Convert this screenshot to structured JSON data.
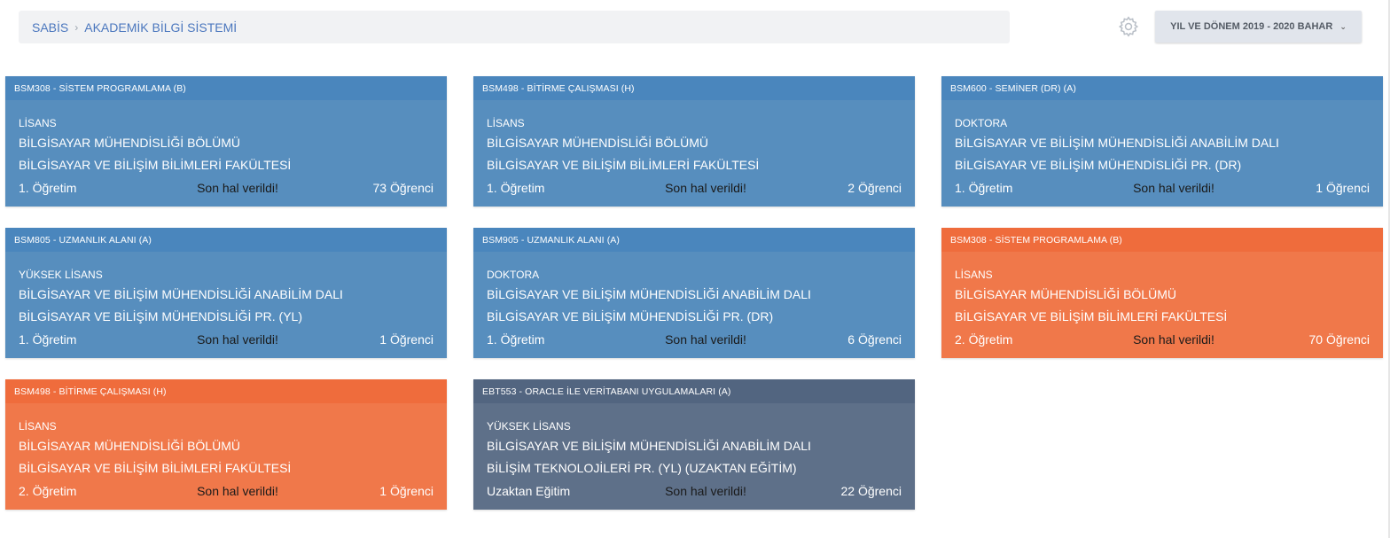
{
  "breadcrumb": {
    "root": "SABİS",
    "separator": "›",
    "current": "AKADEMİK BİLGİ SİSTEMİ"
  },
  "year_selector": {
    "label": "YIL VE DÖNEM 2019 - 2020 BAHAR",
    "chevron": "⌄"
  },
  "icons": {
    "settings": "gear-icon"
  },
  "colors": {
    "blue": "#578ebe",
    "orange": "#f0784a",
    "slate": "#5e7089"
  },
  "cards": [
    {
      "title": "BSM308 - SİSTEM PROGRAMLAMA (B)",
      "level": "LİSANS",
      "line1": "BİLGİSAYAR MÜHENDİSLİĞİ BÖLÜMÜ",
      "line2": "BİLGİSAYAR VE BİLİŞİM BİLİMLERİ FAKÜLTESİ",
      "education": "1. Öğretim",
      "status": "Son hal verildi!",
      "students": "73 Öğrenci",
      "theme": "blue"
    },
    {
      "title": "BSM498 - BİTİRME ÇALIŞMASI (H)",
      "level": "LİSANS",
      "line1": "BİLGİSAYAR MÜHENDİSLİĞİ BÖLÜMÜ",
      "line2": "BİLGİSAYAR VE BİLİŞİM BİLİMLERİ FAKÜLTESİ",
      "education": "1. Öğretim",
      "status": "Son hal verildi!",
      "students": "2 Öğrenci",
      "theme": "blue"
    },
    {
      "title": "BSM600 - SEMİNER (DR) (A)",
      "level": "DOKTORA",
      "line1": "BİLGİSAYAR VE BİLİŞİM MÜHENDİSLİĞİ ANABİLİM DALI",
      "line2": "BİLGİSAYAR VE BİLİŞİM MÜHENDİSLİĞİ PR. (DR)",
      "education": "1. Öğretim",
      "status": "Son hal verildi!",
      "students": "1 Öğrenci",
      "theme": "blue"
    },
    {
      "title": "BSM805 - UZMANLIK ALANI (A)",
      "level": "YÜKSEK LİSANS",
      "line1": "BİLGİSAYAR VE BİLİŞİM MÜHENDİSLİĞİ ANABİLİM DALI",
      "line2": "BİLGİSAYAR VE BİLİŞİM MÜHENDİSLİĞİ PR. (YL)",
      "education": "1. Öğretim",
      "status": "Son hal verildi!",
      "students": "1 Öğrenci",
      "theme": "blue"
    },
    {
      "title": "BSM905 - UZMANLIK ALANI (A)",
      "level": "DOKTORA",
      "line1": "BİLGİSAYAR VE BİLİŞİM MÜHENDİSLİĞİ ANABİLİM DALI",
      "line2": "BİLGİSAYAR VE BİLİŞİM MÜHENDİSLİĞİ PR. (DR)",
      "education": "1. Öğretim",
      "status": "Son hal verildi!",
      "students": "6 Öğrenci",
      "theme": "blue"
    },
    {
      "title": "BSM308 - SİSTEM PROGRAMLAMA (B)",
      "level": "LİSANS",
      "line1": "BİLGİSAYAR MÜHENDİSLİĞİ BÖLÜMÜ",
      "line2": "BİLGİSAYAR VE BİLİŞİM BİLİMLERİ FAKÜLTESİ",
      "education": "2. Öğretim",
      "status": "Son hal verildi!",
      "students": "70 Öğrenci",
      "theme": "orange"
    },
    {
      "title": "BSM498 - BİTİRME ÇALIŞMASI (H)",
      "level": "LİSANS",
      "line1": "BİLGİSAYAR MÜHENDİSLİĞİ BÖLÜMÜ",
      "line2": "BİLGİSAYAR VE BİLİŞİM BİLİMLERİ FAKÜLTESİ",
      "education": "2. Öğretim",
      "status": "Son hal verildi!",
      "students": "1 Öğrenci",
      "theme": "orange"
    },
    {
      "title": "EBT553 - ORACLE İLE VERİTABANI UYGULAMALARI (A)",
      "level": "YÜKSEK LİSANS",
      "line1": "BİLGİSAYAR VE BİLİŞİM MÜHENDİSLİĞİ ANABİLİM DALI",
      "line2": "BİLİŞİM TEKNOLOJİLERİ PR. (YL) (UZAKTAN EĞİTİM)",
      "education": "Uzaktan Eğitim",
      "status": "Son hal verildi!",
      "students": "22 Öğrenci",
      "theme": "slate"
    }
  ]
}
